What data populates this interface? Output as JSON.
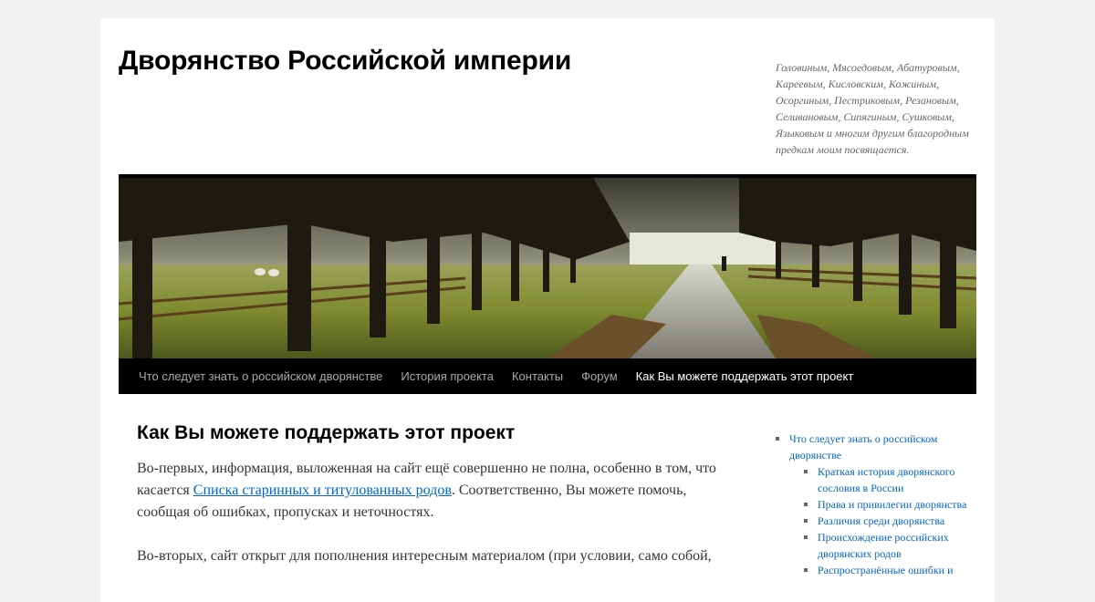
{
  "header": {
    "site_title": "Дворянство Российской империи",
    "site_description": "Головиным, Мясоедовым, Абатуровым, Кареевым, Кисловским, Кожиным, Осоргиным, Пестриковым, Резановым, Селивановым, Сипягиным, Сушковым, Языковым и многим другим благородным предкам моим посвящается.",
    "header_image": "tree-lined-avenue-photo"
  },
  "nav": {
    "items": [
      "Что следует знать о российском дворянстве",
      "История проекта",
      "Контакты",
      "Форум",
      "Как Вы можете поддержать этот проект"
    ],
    "current_index": 4
  },
  "main": {
    "title": "Как Вы можете поддержать этот проект",
    "p1_before": "Во-первых, информация, выложенная на сайт ещё совершенно не полна, особенно в том, что касается ",
    "p1_link": "Списка старинных и титулованных родов",
    "p1_after": ". Соответственно, Вы можете помочь, сообщая об ошибках, пропусках и неточностях.",
    "p2": "Во-вторых, сайт открыт для пополнения интересным материалом (при условии, само собой,"
  },
  "sidebar": {
    "top_item": "Что следует знать о российском дворянстве",
    "children": [
      "Краткая история дворянского сословия в России",
      "Права и привилегии дворянства",
      "Различия среди дворянства",
      "Происхождение российских дворянских родов",
      "Распространённые ошибки и"
    ]
  },
  "colors": {
    "page_bg": "#f1f1f1",
    "nav_bg": "#000000",
    "link": "#0066cc"
  }
}
